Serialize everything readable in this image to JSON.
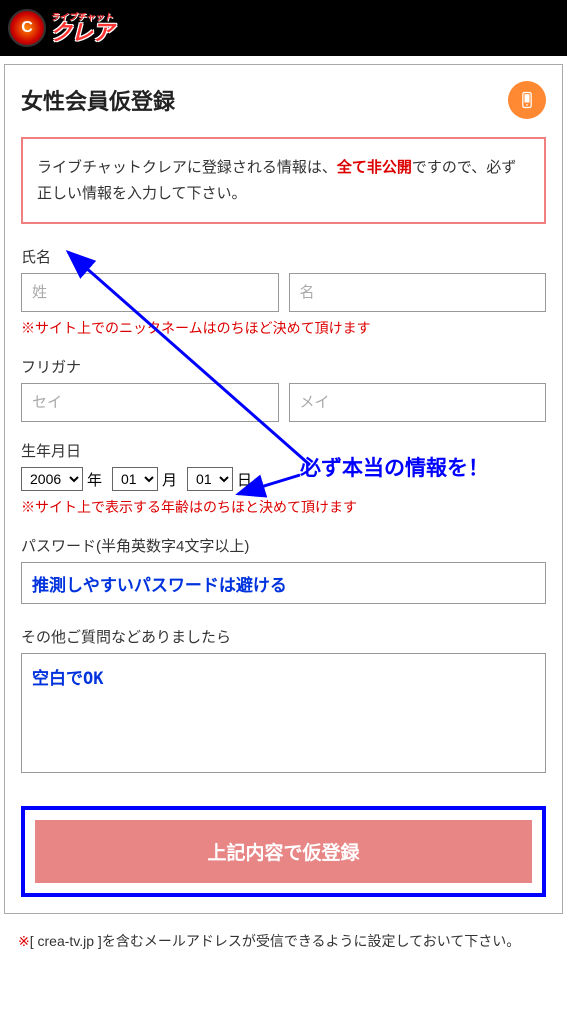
{
  "header": {
    "logo_tagline": "ライブチャット",
    "logo_name": "クレア"
  },
  "page": {
    "title": "女性会員仮登録"
  },
  "notice": {
    "pre": "ライブチャットクレアに登録される情報は、",
    "highlight": "全て非公開",
    "post": "ですので、必ず正しい情報を入力して下さい。"
  },
  "name": {
    "label": "氏名",
    "placeholder_last": "姓",
    "placeholder_first": "名",
    "footnote": "※サイト上でのニックネームはのちほど決めて頂けます"
  },
  "furigana": {
    "label": "フリガナ",
    "placeholder_last": "セイ",
    "placeholder_first": "メイ"
  },
  "birthdate": {
    "label": "生年月日",
    "year": "2006",
    "month": "01",
    "day": "01",
    "year_unit": "年",
    "month_unit": "月",
    "day_unit": "日",
    "footnote": "※サイト上で表示する年齢はのちほと決めて頂けます"
  },
  "password": {
    "label": "パスワード(半角英数字4文字以上)",
    "value": "推測しやすいパスワードは避ける"
  },
  "other": {
    "label": "その他ご質問などありましたら",
    "value": "空白でOK"
  },
  "submit": {
    "label": "上記内容で仮登録"
  },
  "bottom_note": {
    "marker": "※",
    "text": "[ crea-tv.jp ]を含むメールアドレスが受信できるように設定しておいて下さい。"
  },
  "annotation": {
    "text": "必ず本当の情報を！"
  }
}
